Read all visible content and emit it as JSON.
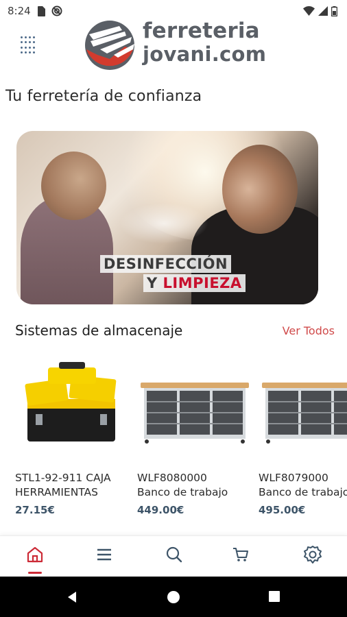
{
  "status_bar": {
    "time": "8:24",
    "icons": [
      "sim-card-icon",
      "do-not-disturb-icon",
      "wifi-icon",
      "signal-icon",
      "battery-icon"
    ]
  },
  "header": {
    "menu_icon": "grid-dots-icon",
    "logo": {
      "line1": "ferreteria",
      "line2": "jovani.com"
    }
  },
  "tagline": "Tu ferretería de confianza",
  "banner": {
    "line1": "DESINFECCIÓN",
    "line2_prefix": "Y ",
    "line2_highlight": "LIMPIEZA"
  },
  "section": {
    "title": "Sistemas de almacenaje",
    "see_all": "Ver Todos"
  },
  "products": [
    {
      "name_line1": "STL1-92-911 CAJA",
      "name_line2": "HERRAMIENTAS",
      "price": "27.15€"
    },
    {
      "name_line1": "WLF8080000",
      "name_line2": "Banco de trabajo",
      "price": "449.00€"
    },
    {
      "name_line1": "WLF8079000",
      "name_line2": "Banco de trabajo",
      "price": "495.00€"
    }
  ],
  "bottom_nav": {
    "items": [
      "home-icon",
      "menu-icon",
      "search-icon",
      "cart-icon",
      "settings-icon"
    ],
    "active": "home-icon",
    "accent": "#cc2a36",
    "icon_color": "#3d5468"
  },
  "colors": {
    "brand_red": "#c8102e",
    "link_red": "#d04a4a",
    "price_blue": "#3d5468",
    "logo_gray": "#5a5f66"
  }
}
